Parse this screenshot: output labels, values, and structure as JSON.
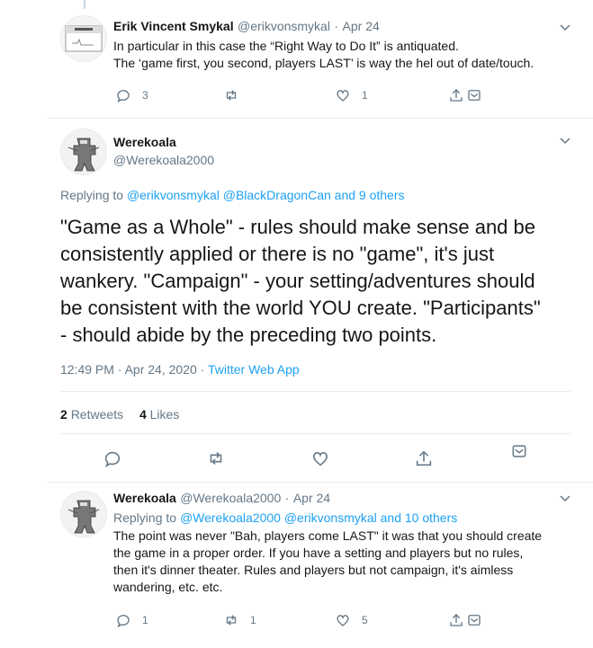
{
  "tweet1": {
    "name": "Erik Vincent Smykal",
    "handle": "@erikvonsmykal",
    "sep": "·",
    "date": "Apr 24",
    "line1": "In particular in this case the “Right Way to Do It” is antiquated.",
    "line2": "The ‘game first, you second, players LAST’ is way the hel out of date/touch.",
    "replies": "3",
    "likes": "1"
  },
  "main": {
    "name": "Werekoala",
    "handle": "@Werekoala2000",
    "replying_prefix": "Replying to",
    "replying_to": "@erikvonsmykal @BlackDragonCan and 9 others",
    "body": [
      "\"Game as a Whole\" - rules should make sense and be",
      "consistently applied or there is no \"game\", it's just",
      "wankery.  \"Campaign\" - your setting/adventures should",
      "be consistent with the world YOU create. \"Participants\"",
      "- should abide by the preceding two points."
    ],
    "timestamp": "12:49 PM · Apr 24, 2020",
    "dot": "·",
    "source": "Twitter Web App",
    "retweets_count": "2",
    "retweets_label": "Retweets",
    "likes_count": "4",
    "likes_label": "Likes"
  },
  "reply": {
    "name": "Werekoala",
    "handle": "@Werekoala2000",
    "sep": "·",
    "date": "Apr 24",
    "replying_prefix": "Replying to",
    "replying_to": "@Werekoala2000 @erikvonsmykal and 10 others",
    "lines": [
      "The point was never \"Bah, players come LAST\" it was that you should create",
      "the game in a proper order. If you have a setting and players but no rules,",
      "then it's dinner theater. Rules and players but not campaign, it's aimless",
      "wandering, etc. etc."
    ],
    "replies": "1",
    "retweets": "1",
    "likes": "5"
  },
  "colors": {
    "accent": "#1da1f2",
    "muted": "#657786",
    "divider": "#e6ecf0"
  }
}
